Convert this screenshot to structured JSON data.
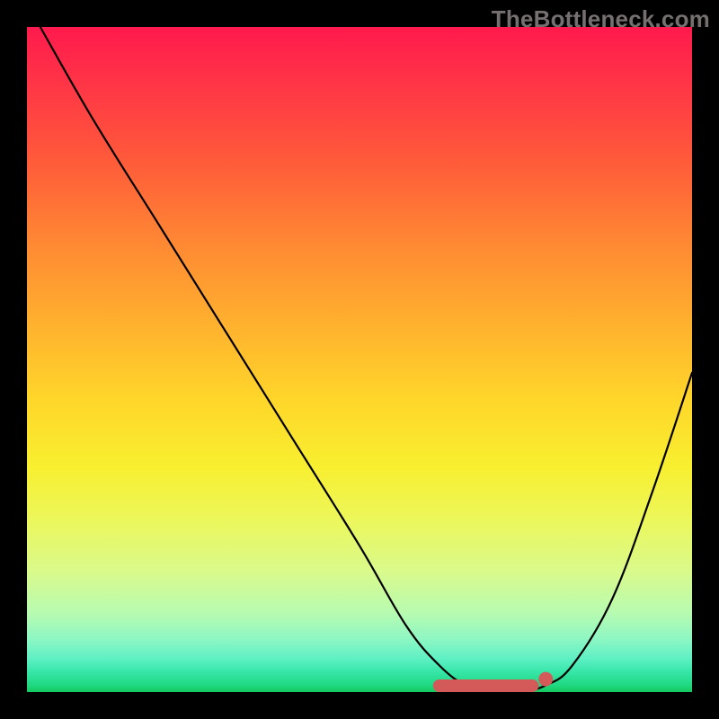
{
  "watermark": "TheBottleneck.com",
  "chart_data": {
    "type": "line",
    "title": "",
    "xlabel": "",
    "ylabel": "",
    "xlim": [
      0,
      100
    ],
    "ylim": [
      0,
      100
    ],
    "grid": false,
    "legend": false,
    "series": [
      {
        "name": "bottleneck-curve",
        "x": [
          2,
          10,
          20,
          30,
          40,
          50,
          57,
          62,
          66,
          70,
          74,
          78,
          82,
          88,
          94,
          100
        ],
        "y": [
          100,
          86,
          70,
          54,
          38,
          22,
          10,
          4,
          1,
          0,
          0,
          1,
          4,
          14,
          30,
          48
        ]
      }
    ],
    "markers": {
      "optimal_band": {
        "x_start": 62,
        "x_end": 76,
        "y": 0
      },
      "optimal_point": {
        "x": 78,
        "y": 1
      }
    },
    "background_gradient": {
      "top": "#ff1a4d",
      "mid": "#ffd62a",
      "bottom": "#14c95e"
    }
  }
}
